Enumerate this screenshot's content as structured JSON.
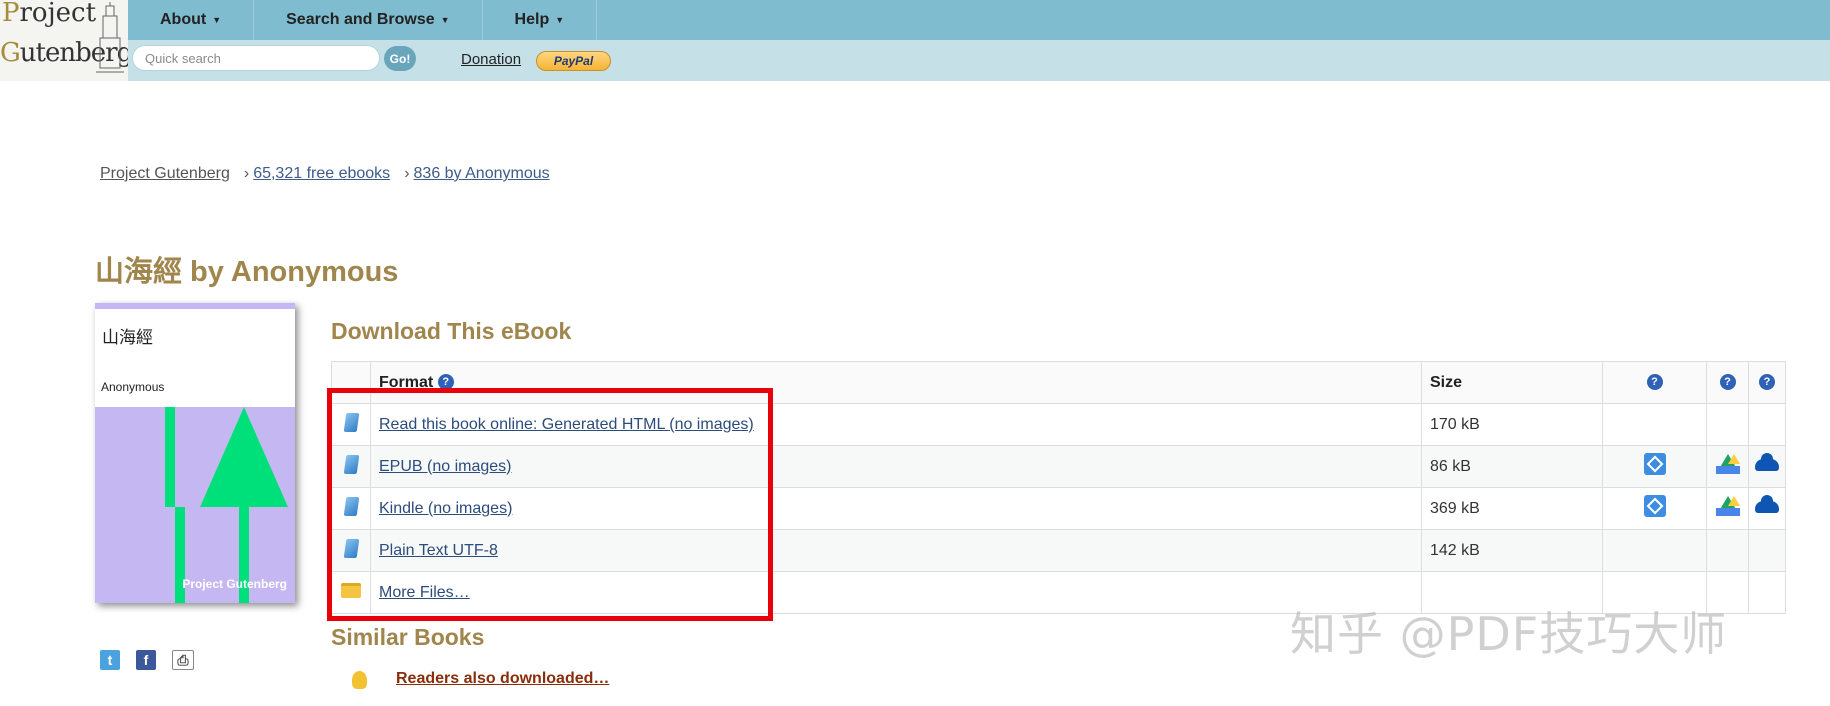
{
  "logo": {
    "line1_cap": "P",
    "line1_rest": "roject",
    "line2_cap": "G",
    "line2_rest": "utenberg"
  },
  "nav": {
    "items": [
      {
        "label": "About"
      },
      {
        "label": "Search and Browse"
      },
      {
        "label": "Help"
      }
    ],
    "search_placeholder": "Quick search",
    "go_label": "Go!",
    "donation_label": "Donation",
    "paypal_label": "PayPal"
  },
  "breadcrumb": {
    "home": "Project Gutenberg",
    "crumb2": "65,321 free ebooks",
    "crumb3": "836 by Anonymous",
    "sep": "›"
  },
  "title": "山海經 by Anonymous",
  "cover": {
    "title": "山海經",
    "author": "Anonymous",
    "brand": "Project Gutenberg",
    "colors": {
      "background": "#c5b8f2",
      "arrow": "#00e07a"
    }
  },
  "download": {
    "heading": "Download This eBook",
    "columns": {
      "format": "Format",
      "size": "Size"
    },
    "rows": [
      {
        "format": "Read this book online: Generated HTML (no images)",
        "size": "170 kB",
        "icon": "book-icon",
        "dropbox": false,
        "gdrive": false,
        "onedrive": false
      },
      {
        "format": "EPUB (no images)",
        "size": "86 kB",
        "icon": "book-icon",
        "dropbox": true,
        "gdrive": true,
        "onedrive": true
      },
      {
        "format": "Kindle (no images)",
        "size": "369 kB",
        "icon": "book-icon",
        "dropbox": true,
        "gdrive": true,
        "onedrive": true
      },
      {
        "format": "Plain Text UTF-8",
        "size": "142 kB",
        "icon": "book-icon",
        "dropbox": false,
        "gdrive": false,
        "onedrive": false
      },
      {
        "format": "More Files…",
        "size": "",
        "icon": "folder-icon",
        "dropbox": false,
        "gdrive": false,
        "onedrive": false
      }
    ]
  },
  "similar": {
    "heading": "Similar Books",
    "link": "Readers also downloaded…"
  },
  "watermark": "知乎 @PDF技巧大师",
  "colors": {
    "header_top": "#7fbccf",
    "header_bottom": "#c6e0e8",
    "heading": "#a0864c",
    "highlight": "#e8000b"
  }
}
